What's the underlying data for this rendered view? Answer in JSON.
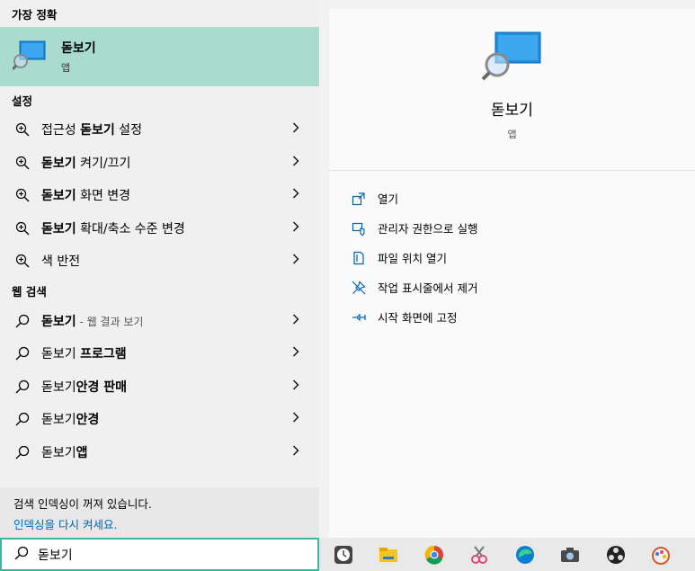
{
  "best_match_header": "가장 정확",
  "best_match": {
    "title": "돋보기",
    "subtitle": "앱"
  },
  "settings_header": "설정",
  "settings_items": [
    {
      "pre": "접근성 ",
      "bold": "돋보기",
      "post": " 설정"
    },
    {
      "pre": "",
      "bold": "돋보기",
      "post": " 켜기/끄기"
    },
    {
      "pre": "",
      "bold": "돋보기",
      "post": " 화면 변경"
    },
    {
      "pre": "",
      "bold": "돋보기",
      "post": " 확대/축소 수준 변경"
    },
    {
      "pre": "색 반전",
      "bold": "",
      "post": ""
    }
  ],
  "web_header": "웹 검색",
  "web_items": [
    {
      "normal": "돋보기",
      "bold": "",
      "hint": " - 웹 결과 보기"
    },
    {
      "normal": "돋보기 ",
      "bold": "프로그램",
      "hint": ""
    },
    {
      "normal": "돋보기",
      "bold": "안경 판매",
      "hint": ""
    },
    {
      "normal": "돋보기",
      "bold": "안경",
      "hint": ""
    },
    {
      "normal": "돋보기",
      "bold": "앱",
      "hint": ""
    }
  ],
  "index_notice": {
    "text": "검색 인덱싱이 꺼져 있습니다.",
    "link": "인덱싱을 다시 켜세요."
  },
  "preview": {
    "title": "돋보기",
    "subtitle": "앱"
  },
  "actions": [
    {
      "icon": "open-icon",
      "label": "열기"
    },
    {
      "icon": "admin-shield-icon",
      "label": "관리자 권한으로 실행"
    },
    {
      "icon": "file-location-icon",
      "label": "파일 위치 열기"
    },
    {
      "icon": "unpin-taskbar-icon",
      "label": "작업 표시줄에서 제거"
    },
    {
      "icon": "pin-start-icon",
      "label": "시작 화면에 고정"
    }
  ],
  "search": {
    "value": "돋보기"
  },
  "taskbar_icons": [
    "clock-app-icon",
    "file-explorer-icon",
    "chrome-icon",
    "snipping-tool-icon",
    "edge-icon",
    "camera-icon",
    "obs-icon",
    "paint-icon"
  ],
  "colors": {
    "accent": "#a9dccf",
    "search_border": "#3cb89f",
    "link": "#0063b1"
  }
}
